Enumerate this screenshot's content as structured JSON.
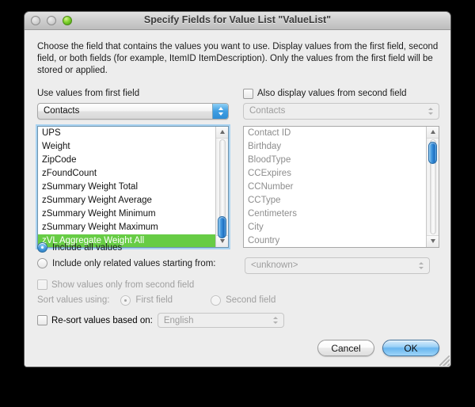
{
  "window": {
    "title": "Specify Fields for Value List \"ValueList\"",
    "traffic_lights": [
      {
        "name": "close-button",
        "state": "disabled"
      },
      {
        "name": "minimize-button",
        "state": "disabled"
      },
      {
        "name": "zoom-button",
        "state": "enabled",
        "color": "#81d32e"
      }
    ]
  },
  "instructions": "Choose the field that contains the values you want to use.  Display values from the first field, second field, or both fields (for example, ItemID ItemDescription). Only the values from the first field will be stored or applied.",
  "first_field": {
    "label": "Use values from first field",
    "table_popup_value": "Contacts",
    "fields": [
      {
        "label": "UPS",
        "selected": false
      },
      {
        "label": "Weight",
        "selected": false
      },
      {
        "label": "ZipCode",
        "selected": false
      },
      {
        "label": "zFoundCount",
        "selected": false
      },
      {
        "label": "zSummary Weight Total",
        "selected": false
      },
      {
        "label": "zSummary Weight Average",
        "selected": false
      },
      {
        "label": "zSummary Weight Minimum",
        "selected": false
      },
      {
        "label": "zSummary Weight Maximum",
        "selected": false
      },
      {
        "label": "zVL Aggregate Weight All",
        "selected": true
      }
    ],
    "selection_color": "#67cc45",
    "scroll_position": "near-bottom"
  },
  "second_field": {
    "checkbox_label": "Also display values from second field",
    "checkbox_checked": false,
    "table_popup_value": "Contacts",
    "enabled": false,
    "fields": [
      {
        "label": "Contact ID"
      },
      {
        "label": "Birthday"
      },
      {
        "label": "BloodType"
      },
      {
        "label": "CCExpires"
      },
      {
        "label": "CCNumber"
      },
      {
        "label": "CCType"
      },
      {
        "label": "Centimeters"
      },
      {
        "label": "City"
      },
      {
        "label": "Country"
      }
    ],
    "scroll_position": "near-top"
  },
  "options": {
    "include_all_values": {
      "label": "Include all values",
      "selected": true
    },
    "include_related_values": {
      "label": "Include only related values starting from:",
      "selected": false
    },
    "related_popup_value": "<unknown>",
    "show_values_only_second_field": {
      "label": "Show values only from second field",
      "checked": false,
      "enabled": false
    },
    "sort_values_using": {
      "label": "Sort values using:",
      "enabled": false,
      "choices": [
        {
          "label": "First field",
          "selected": true
        },
        {
          "label": "Second field",
          "selected": false
        }
      ]
    },
    "resort": {
      "label": "Re-sort values based on:",
      "checked": false,
      "popup_value": "English",
      "enabled": false
    }
  },
  "buttons": {
    "cancel": "Cancel",
    "ok": "OK"
  }
}
